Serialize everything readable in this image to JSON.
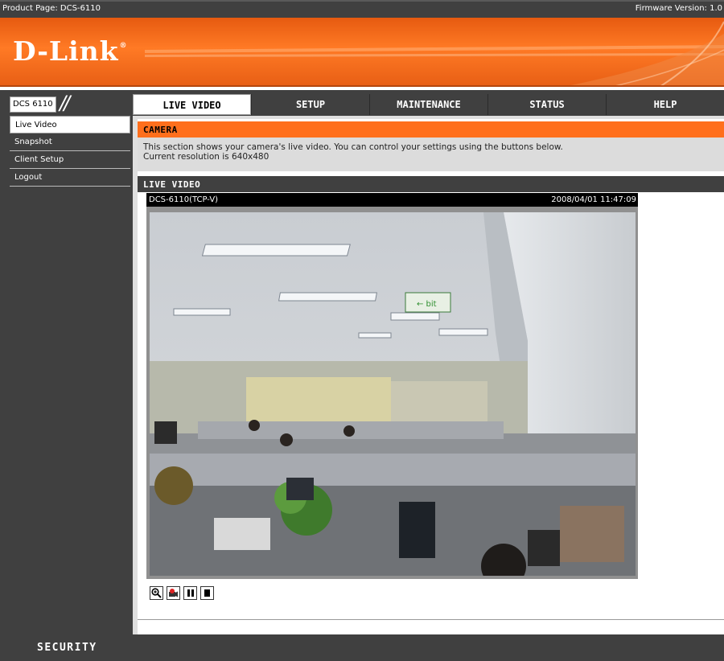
{
  "top": {
    "product_page": "Product Page: DCS-6110",
    "firmware": "Firmware Version: 1.0"
  },
  "brand": {
    "logo": "D-Link",
    "logo_mark": "®",
    "accent": "#ff6f1c",
    "dark": "#404040"
  },
  "nav": {
    "model": "DCS 6110",
    "tabs": [
      {
        "label": "LIVE VIDEO",
        "active": true
      },
      {
        "label": "SETUP",
        "active": false
      },
      {
        "label": "MAINTENANCE",
        "active": false
      },
      {
        "label": "STATUS",
        "active": false
      },
      {
        "label": "HELP",
        "active": false
      }
    ]
  },
  "sidebar": {
    "items": [
      {
        "label": "Live Video",
        "active": true
      },
      {
        "label": "Snapshot",
        "active": false
      },
      {
        "label": "Client Setup",
        "active": false
      },
      {
        "label": "Logout",
        "active": false
      }
    ]
  },
  "camera": {
    "title": "CAMERA",
    "desc_line1": "This section shows your camera's live video. You can control your settings using the buttons below.",
    "desc_line2": "Current resolution is 640x480"
  },
  "live": {
    "title": "LIVE VIDEO",
    "camera_name": "DCS-6110(TCP-V)",
    "timestamp": "2008/04/01 11:47:09",
    "controls": [
      "zoom-icon",
      "record-icon",
      "pause-icon",
      "stop-icon"
    ]
  },
  "footer": {
    "label": "SECURITY"
  }
}
